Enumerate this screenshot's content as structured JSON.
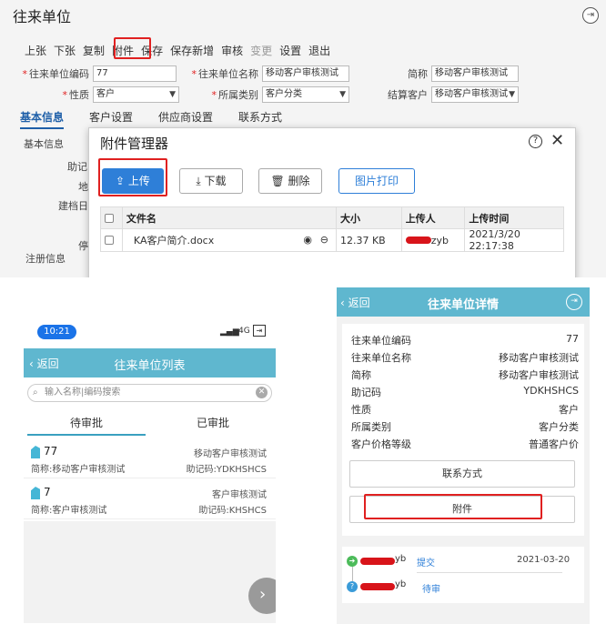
{
  "desktop": {
    "title": "往来单位",
    "toolbar": [
      "上张",
      "下张",
      "复制",
      "附件",
      "保存",
      "保存新增",
      "审核",
      "变更",
      "设置",
      "退出"
    ],
    "fields": {
      "code_label": "往来单位编码",
      "code_value": "77",
      "name_label": "往来单位名称",
      "name_value": "移动客户审核测试",
      "short_label": "简称",
      "short_value": "移动客户审核测试",
      "nature_label": "性质",
      "nature_value": "客户",
      "category_label": "所属类别",
      "category_value": "客户分类",
      "settle_label": "结算客户",
      "settle_value": "移动客户审核测试"
    },
    "tabs": [
      "基本信息",
      "客户设置",
      "供应商设置",
      "联系方式"
    ],
    "side_labels": {
      "basic": "基本信息",
      "memo": "助记",
      "addr": "地",
      "date": "建档日",
      "stop": "停",
      "reg": "注册信息"
    }
  },
  "modal": {
    "title": "附件管理器",
    "buttons": {
      "upload": "上传",
      "download": "下载",
      "delete": "删除",
      "print": "图片打印"
    },
    "columns": {
      "filename": "文件名",
      "size": "大小",
      "uploader": "上传人",
      "time": "上传时间"
    },
    "file": {
      "name": "KA客户简介.docx",
      "size": "12.37 KB",
      "uploader_suffix": "zyb",
      "time": "2021/3/20 22:17:38"
    }
  },
  "mobile_list": {
    "time": "10:21",
    "signal": "4G",
    "back": "返回",
    "title": "往来单位列表",
    "search_placeholder": "输入名称|编码搜索",
    "tabs": [
      "待审批",
      "已审批"
    ],
    "items": [
      {
        "code": "77",
        "name": "移动客户审核测试",
        "short": "简称:移动客户审核测试",
        "memo": "助记码:YDKHSHCS"
      },
      {
        "code": "7",
        "name": "客户审核测试",
        "short": "简称:客户审核测试",
        "memo": "助记码:KHSHCS"
      }
    ]
  },
  "mobile_detail": {
    "back": "返回",
    "title": "往来单位详情",
    "rows": [
      {
        "label": "往来单位编码",
        "value": "77"
      },
      {
        "label": "往来单位名称",
        "value": "移动客户审核测试"
      },
      {
        "label": "简称",
        "value": "移动客户审核测试"
      },
      {
        "label": "助记码",
        "value": "YDKHSHCS"
      },
      {
        "label": "性质",
        "value": "客户"
      },
      {
        "label": "所属类别",
        "value": "客户分类"
      },
      {
        "label": "客户价格等级",
        "value": "普通客户价"
      }
    ],
    "contact_button": "联系方式",
    "attach_button": "附件",
    "workflow": [
      {
        "user_suffix": "yb",
        "action": "提交",
        "date": "2021-03-20"
      },
      {
        "user_suffix": "yb",
        "action": "待审",
        "date": ""
      }
    ]
  },
  "colors": {
    "accent": "#5fb7cf",
    "primary": "#2e7fd8",
    "highlight": "#e02020"
  }
}
